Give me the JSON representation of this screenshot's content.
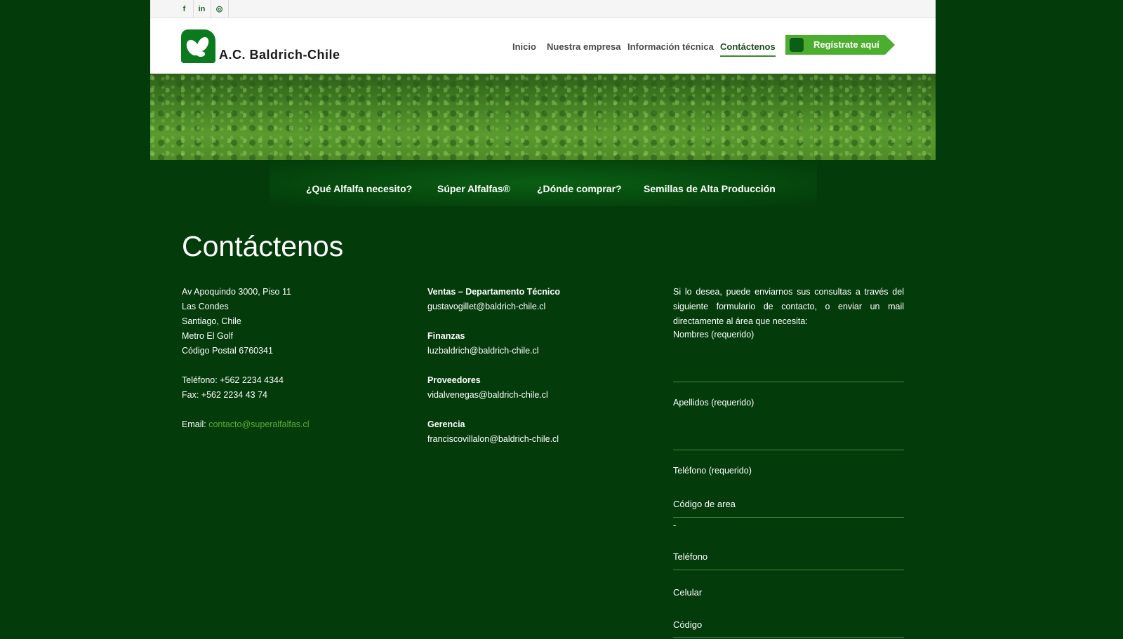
{
  "social": {
    "facebook": "f",
    "linkedin": "in",
    "instagram": "◎"
  },
  "logo": {
    "text": "A.C. Baldrich-Chile"
  },
  "nav": {
    "items": [
      "Inicio",
      "Nuestra empresa",
      "Información técnica",
      "Contáctenos"
    ],
    "register_label": "Regístrate aquí"
  },
  "subnav": {
    "items": [
      "¿Qué Alfalfa necesito?",
      "Súper Alfalfas®",
      "¿Dónde comprar?",
      "Semillas de Alta Producción"
    ]
  },
  "page": {
    "title": "Contáctenos"
  },
  "address": {
    "lines": [
      "Av Apoquindo 3000, Piso 11",
      "Las Condes",
      "Santiago, Chile",
      "Metro El Golf",
      "Código Postal 6760341"
    ],
    "phone": "Teléfono: +562 2234 4344",
    "fax": "Fax: +562 2234 43 74",
    "email_label": "Email:",
    "email": "contacto@superalfalfas.cl"
  },
  "departments": [
    {
      "name": "Ventas – Departamento Técnico",
      "email": "gustavogillet@baldrich-chile.cl"
    },
    {
      "name": "Finanzas",
      "email": "luzbaldrich@baldrich-chile.cl"
    },
    {
      "name": "Proveedores",
      "email": "vidalvenegas@baldrich-chile.cl"
    },
    {
      "name": "Gerencia",
      "email": "franciscovillalon@baldrich-chile.cl"
    }
  ],
  "form": {
    "intro": "Si lo desea, puede enviarnos sus consultas a través del siguiente formulario de contacto, o enviar un mail directamente al área que necesita:",
    "nombres_label": "Nombres (requerido)",
    "apellidos_label": "Apellidos (requerido)",
    "telefono_label": "Teléfono (requerido)",
    "codigo_area": "Código de area",
    "dash": "-",
    "telefono": "Teléfono",
    "celular": "Celular",
    "codigo": "Código"
  },
  "colors": {
    "background": "#033b0a",
    "accent": "#4cae2e",
    "link": "#58b03a"
  }
}
